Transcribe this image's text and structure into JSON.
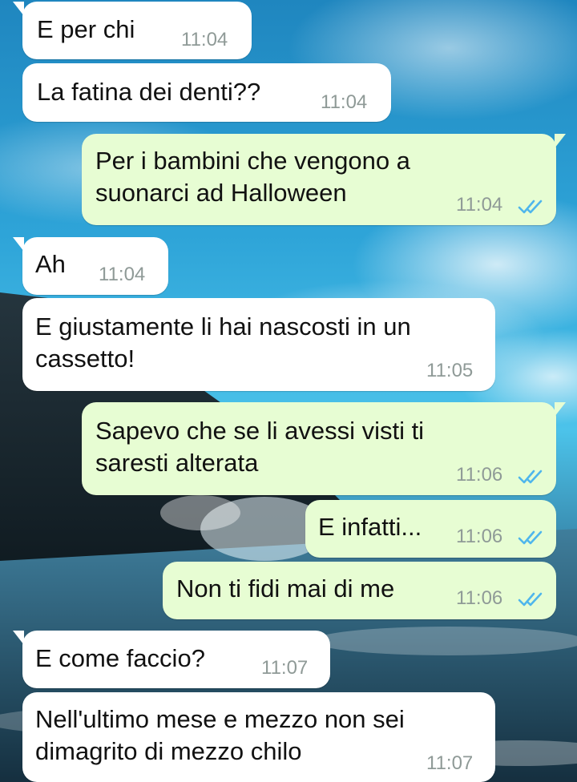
{
  "theme": {
    "incoming_bubble": "#ffffff",
    "outgoing_bubble": "#e7fdd3",
    "read_tick_color": "#4fb6ec",
    "time_color": "#8f9a97",
    "background": "ocean-sky-photo"
  },
  "messages": [
    {
      "direction": "incoming",
      "text": "E per chi",
      "time": "11:04"
    },
    {
      "direction": "incoming",
      "text": "La fatina dei denti??",
      "time": "11:04"
    },
    {
      "direction": "outgoing",
      "text": "Per i bambini che vengono a\nsuonarci ad Halloween",
      "time": "11:04",
      "status": "read",
      "status_icon": "double-check-icon"
    },
    {
      "direction": "incoming",
      "text": "Ah",
      "time": "11:04"
    },
    {
      "direction": "incoming",
      "text": "E giustamente li hai nascosti in un\ncassetto!",
      "time": "11:05"
    },
    {
      "direction": "outgoing",
      "text": "Sapevo che se li avessi visti ti\nsaresti alterata",
      "time": "11:06",
      "status": "read",
      "status_icon": "double-check-icon"
    },
    {
      "direction": "outgoing",
      "text": "E infatti...",
      "time": "11:06",
      "status": "read",
      "status_icon": "double-check-icon"
    },
    {
      "direction": "outgoing",
      "text": "Non ti fidi mai di me",
      "time": "11:06",
      "status": "read",
      "status_icon": "double-check-icon"
    },
    {
      "direction": "incoming",
      "text": "E come faccio?",
      "time": "11:07"
    },
    {
      "direction": "incoming",
      "text": "Nell'ultimo mese e mezzo non sei\ndimagrito di mezzo chilo",
      "time": "11:07"
    }
  ]
}
